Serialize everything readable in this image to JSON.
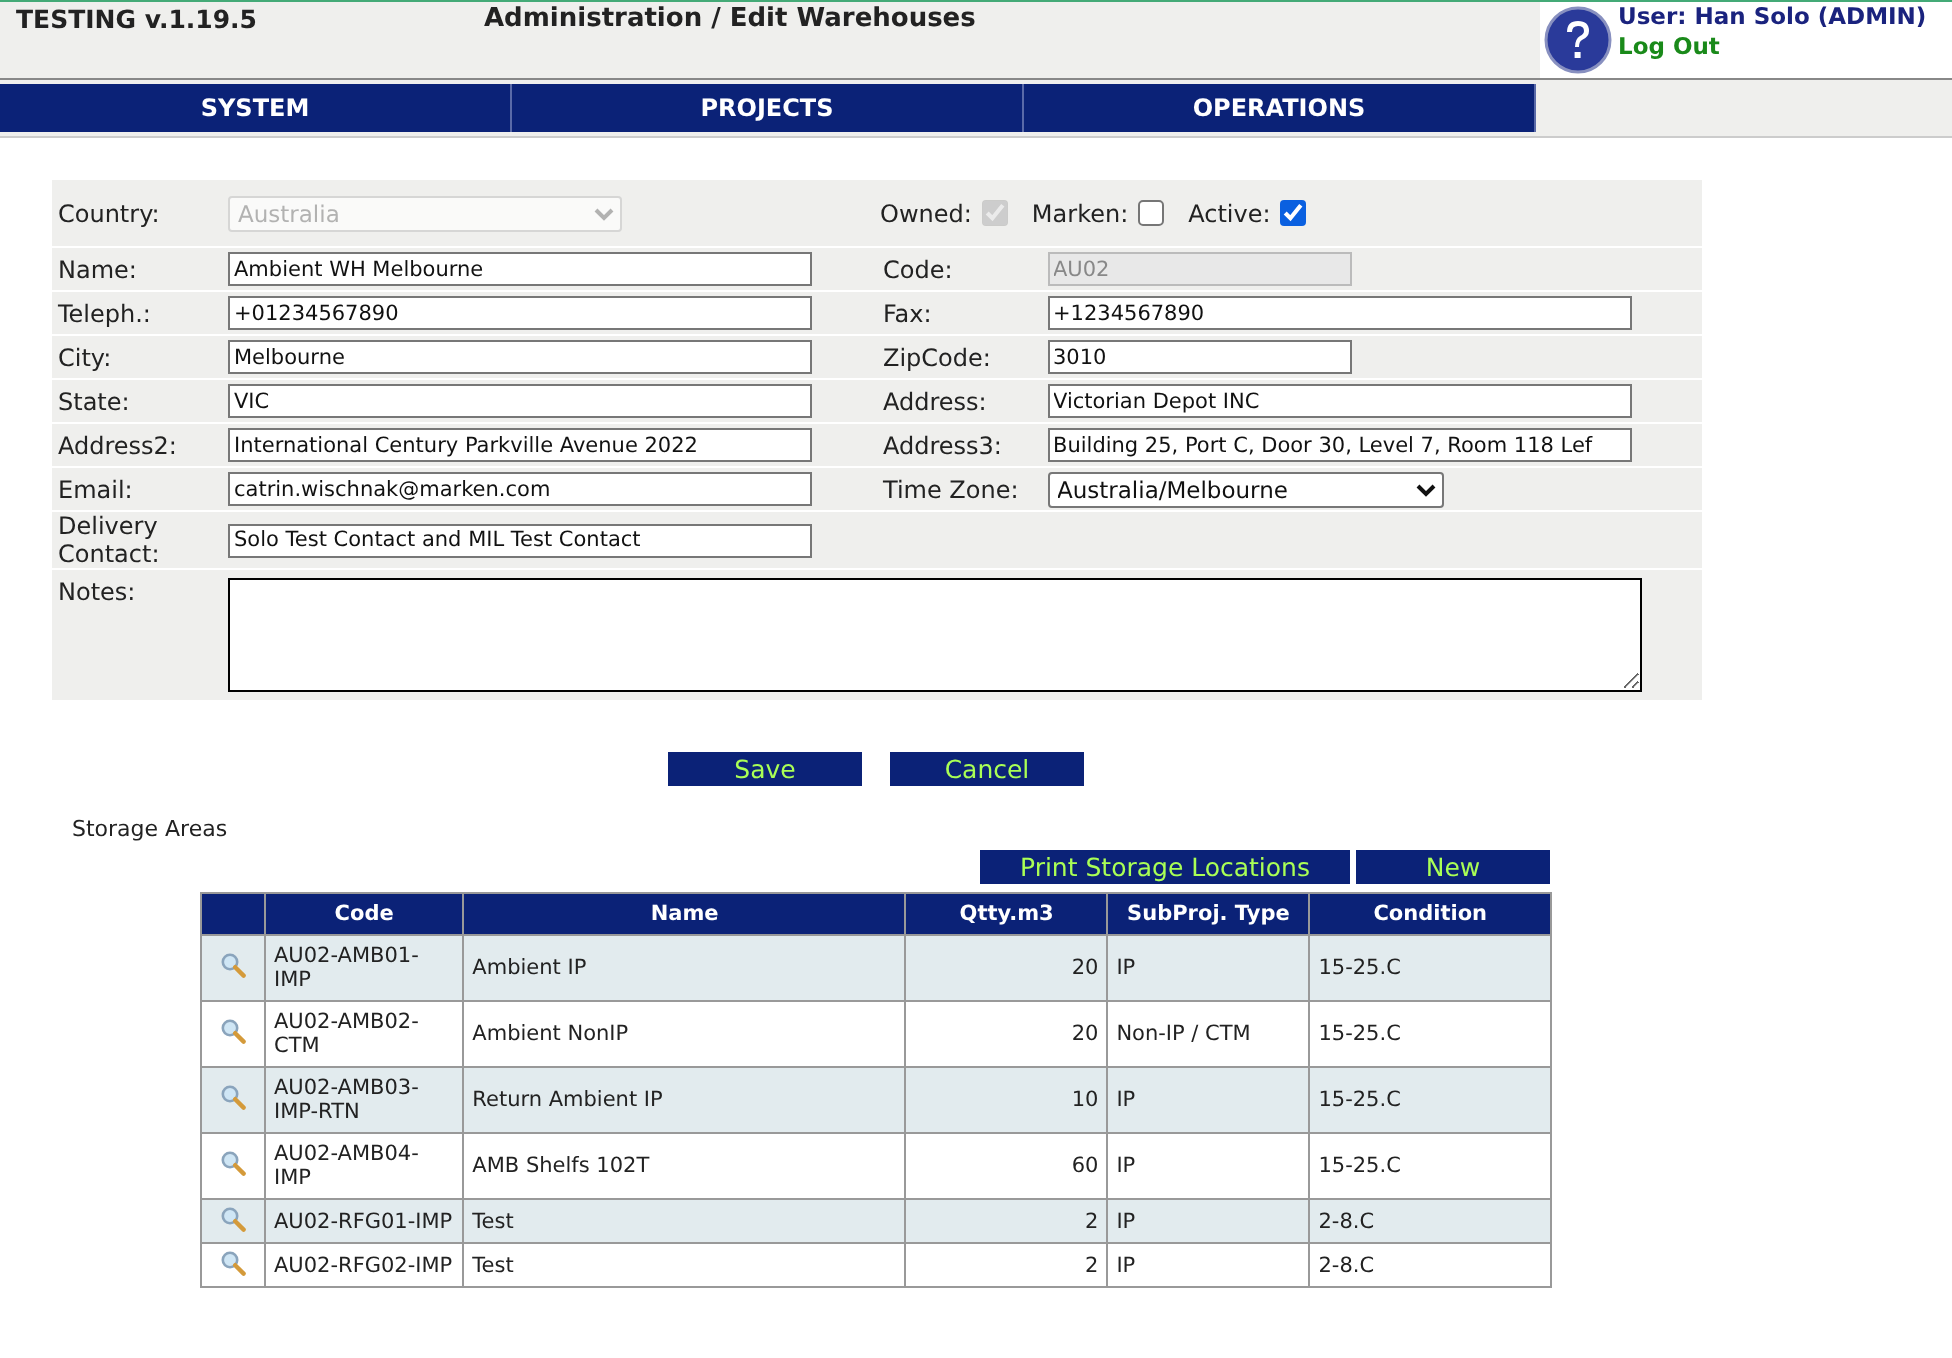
{
  "header": {
    "version": "TESTING v.1.19.5",
    "title": "Administration / Edit Warehouses",
    "user": "User: Han Solo (ADMIN)",
    "logout": "Log Out"
  },
  "nav": [
    "SYSTEM",
    "PROJECTS",
    "OPERATIONS"
  ],
  "form": {
    "country": {
      "label": "Country:",
      "value": "Australia",
      "disabled": true
    },
    "flags": [
      {
        "label": "Owned:",
        "checked": true,
        "disabled": true
      },
      {
        "label": "Marken:",
        "checked": false,
        "disabled": false
      },
      {
        "label": "Active:",
        "checked": true,
        "disabled": false
      }
    ],
    "rows": [
      [
        {
          "label": "Name:",
          "value": "Ambient WH Melbourne",
          "kind": "text"
        },
        {
          "label": "Code:",
          "value": "AU02",
          "kind": "shorttext",
          "disabled": true
        }
      ],
      [
        {
          "label": "Teleph.:",
          "value": "+01234567890",
          "kind": "text"
        },
        {
          "label": "Fax:",
          "value": "+1234567890",
          "kind": "text"
        }
      ],
      [
        {
          "label": "City:",
          "value": "Melbourne",
          "kind": "text"
        },
        {
          "label": "ZipCode:",
          "value": "3010",
          "kind": "shorttext"
        }
      ],
      [
        {
          "label": "State:",
          "value": "VIC",
          "kind": "text"
        },
        {
          "label": "Address:",
          "value": "Victorian Depot INC",
          "kind": "text"
        }
      ],
      [
        {
          "label": "Address2:",
          "value": "International Century Parkville Avenue 2022",
          "kind": "text"
        },
        {
          "label": "Address3:",
          "value": "Building 25, Port C, Door 30, Level 7, Room 118 Lef",
          "kind": "text"
        }
      ],
      [
        {
          "label": "Email:",
          "value": "catrin.wischnak@marken.com",
          "kind": "text"
        },
        {
          "label": "Time Zone:",
          "value": "Australia/Melbourne",
          "kind": "select"
        }
      ],
      [
        {
          "label": "Delivery Contact:",
          "value": "Solo Test Contact and MIL Test Contact",
          "kind": "text"
        }
      ]
    ],
    "notes": {
      "label": "Notes:"
    }
  },
  "buttons": [
    "Save",
    "Cancel"
  ],
  "storage": {
    "title": "Storage Areas",
    "actions": [
      "Print Storage Locations",
      "New"
    ],
    "columns": [
      "Code",
      "Name",
      "Qtty.m3",
      "SubProj. Type",
      "Condition"
    ],
    "rows": [
      [
        "AU02-AMB01-IMP",
        "Ambient IP",
        "20",
        "IP",
        "15-25.C"
      ],
      [
        "AU02-AMB02-CTM",
        "Ambient NonIP",
        "20",
        "Non-IP / CTM",
        "15-25.C"
      ],
      [
        "AU02-AMB03-IMP-RTN",
        "Return Ambient IP",
        "10",
        "IP",
        "15-25.C"
      ],
      [
        "AU02-AMB04-IMP",
        "AMB Shelfs 102T",
        "60",
        "IP",
        "15-25.C"
      ],
      [
        "AU02-RFG01-IMP",
        "Test",
        "2",
        "IP",
        "2-8.C"
      ],
      [
        "AU02-RFG02-IMP",
        "Test",
        "2",
        "IP",
        "2-8.C"
      ]
    ]
  }
}
